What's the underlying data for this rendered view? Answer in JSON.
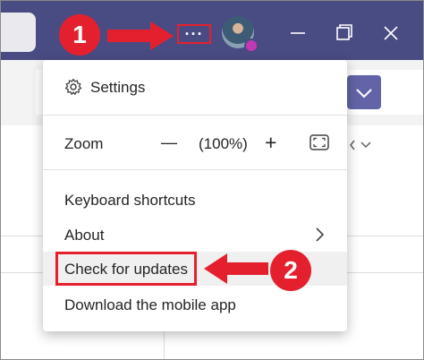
{
  "title_bar": {
    "more_label": "···",
    "icons": [
      "more-options-icon",
      "avatar",
      "minimize-icon",
      "maximize-icon",
      "close-icon"
    ]
  },
  "menu": {
    "settings_label": "Settings",
    "zoom_label": "Zoom",
    "zoom_value": "(100%)",
    "zoom_out_label": "—",
    "zoom_in_label": "+",
    "keyboard_label": "Keyboard shortcuts",
    "about_label": "About",
    "update_label": "Check for updates",
    "mobile_label": "Download the mobile app"
  },
  "annotations": {
    "step1": "1",
    "step2": "2"
  },
  "colors": {
    "titlebar": "#494b83",
    "annotation_red": "#e5202e",
    "accent": "#6264a7"
  }
}
